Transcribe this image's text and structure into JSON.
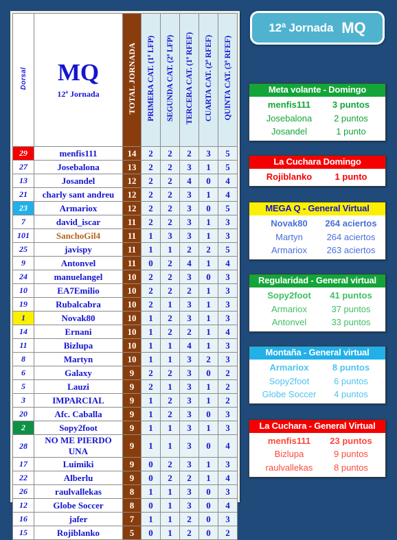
{
  "background_color": "#1f4a7a",
  "title_badge": {
    "jornada": "12ª Jornada",
    "name": "MQ",
    "bg_color": "#4fb3cf"
  },
  "table": {
    "header": {
      "dorsal": "Dorsal",
      "title_big": "MQ",
      "title_small": "12ª Jornada",
      "total": "TOTAL JORNADA",
      "cat1": "PRIMERA CAT. (1ª LFP)",
      "cat2": "SEGUNDA CAT. (2ª LFP)",
      "cat3": "TERCERA CAT. (1ª RFEF)",
      "cat4": "CUARTA CAT. (2ª RFEF)",
      "cat5": "QUINTA CAT. (3ª RFEF)"
    },
    "rows": [
      {
        "dorsal": "29",
        "name": "menfis111",
        "total": "14",
        "c1": "2",
        "c2": "2",
        "c3": "2",
        "c4": "3",
        "c5": "5",
        "dorsal_bg": "#f50000",
        "dorsal_fg": "#ffffff",
        "name_fg": "#1515cf"
      },
      {
        "dorsal": "27",
        "name": "Josebalona",
        "total": "13",
        "c1": "2",
        "c2": "2",
        "c3": "3",
        "c4": "1",
        "c5": "5",
        "dorsal_bg": "#ffffff",
        "dorsal_fg": "#1515cf",
        "name_fg": "#1515cf"
      },
      {
        "dorsal": "13",
        "name": "Josandel",
        "total": "12",
        "c1": "2",
        "c2": "2",
        "c3": "4",
        "c4": "0",
        "c5": "4",
        "dorsal_bg": "#ffffff",
        "dorsal_fg": "#1515cf",
        "name_fg": "#1515cf"
      },
      {
        "dorsal": "21",
        "name": "charly sant andreu",
        "total": "12",
        "c1": "2",
        "c2": "2",
        "c3": "3",
        "c4": "1",
        "c5": "4",
        "dorsal_bg": "#ffffff",
        "dorsal_fg": "#1515cf",
        "name_fg": "#1515cf"
      },
      {
        "dorsal": "23",
        "name": "Armariox",
        "total": "12",
        "c1": "2",
        "c2": "2",
        "c3": "3",
        "c4": "0",
        "c5": "5",
        "dorsal_bg": "#22b0e8",
        "dorsal_fg": "#ffffff",
        "name_fg": "#1515cf"
      },
      {
        "dorsal": "7",
        "name": "david_iscar",
        "total": "11",
        "c1": "2",
        "c2": "2",
        "c3": "3",
        "c4": "1",
        "c5": "3",
        "dorsal_bg": "#ffffff",
        "dorsal_fg": "#1515cf",
        "name_fg": "#1515cf"
      },
      {
        "dorsal": "101",
        "name": "SanchoGil4",
        "total": "11",
        "c1": "1",
        "c2": "3",
        "c3": "3",
        "c4": "1",
        "c5": "3",
        "dorsal_bg": "#ffffff",
        "dorsal_fg": "#1515cf",
        "name_fg": "#b5651d"
      },
      {
        "dorsal": "25",
        "name": "javispy",
        "total": "11",
        "c1": "1",
        "c2": "1",
        "c3": "2",
        "c4": "2",
        "c5": "5",
        "dorsal_bg": "#ffffff",
        "dorsal_fg": "#1515cf",
        "name_fg": "#1515cf"
      },
      {
        "dorsal": "9",
        "name": "Antonvel",
        "total": "11",
        "c1": "0",
        "c2": "2",
        "c3": "4",
        "c4": "1",
        "c5": "4",
        "dorsal_bg": "#ffffff",
        "dorsal_fg": "#1515cf",
        "name_fg": "#1515cf"
      },
      {
        "dorsal": "24",
        "name": "manuelangel",
        "total": "10",
        "c1": "2",
        "c2": "2",
        "c3": "3",
        "c4": "0",
        "c5": "3",
        "dorsal_bg": "#ffffff",
        "dorsal_fg": "#1515cf",
        "name_fg": "#1515cf"
      },
      {
        "dorsal": "10",
        "name": "EA7Emilio",
        "total": "10",
        "c1": "2",
        "c2": "2",
        "c3": "2",
        "c4": "1",
        "c5": "3",
        "dorsal_bg": "#ffffff",
        "dorsal_fg": "#1515cf",
        "name_fg": "#1515cf"
      },
      {
        "dorsal": "19",
        "name": "Rubalcabra",
        "total": "10",
        "c1": "2",
        "c2": "1",
        "c3": "3",
        "c4": "1",
        "c5": "3",
        "dorsal_bg": "#ffffff",
        "dorsal_fg": "#1515cf",
        "name_fg": "#1515cf"
      },
      {
        "dorsal": "1",
        "name": "Novak80",
        "total": "10",
        "c1": "1",
        "c2": "2",
        "c3": "3",
        "c4": "1",
        "c5": "3",
        "dorsal_bg": "#fbf000",
        "dorsal_fg": "#1515cf",
        "name_fg": "#1515cf"
      },
      {
        "dorsal": "14",
        "name": "Ernani",
        "total": "10",
        "c1": "1",
        "c2": "2",
        "c3": "2",
        "c4": "1",
        "c5": "4",
        "dorsal_bg": "#ffffff",
        "dorsal_fg": "#1515cf",
        "name_fg": "#1515cf"
      },
      {
        "dorsal": "11",
        "name": "Bizlupa",
        "total": "10",
        "c1": "1",
        "c2": "1",
        "c3": "4",
        "c4": "1",
        "c5": "3",
        "dorsal_bg": "#ffffff",
        "dorsal_fg": "#1515cf",
        "name_fg": "#1515cf"
      },
      {
        "dorsal": "8",
        "name": "Martyn",
        "total": "10",
        "c1": "1",
        "c2": "1",
        "c3": "3",
        "c4": "2",
        "c5": "3",
        "dorsal_bg": "#ffffff",
        "dorsal_fg": "#1515cf",
        "name_fg": "#1515cf"
      },
      {
        "dorsal": "6",
        "name": "Galaxy",
        "total": "9",
        "c1": "2",
        "c2": "2",
        "c3": "3",
        "c4": "0",
        "c5": "2",
        "dorsal_bg": "#ffffff",
        "dorsal_fg": "#1515cf",
        "name_fg": "#1515cf"
      },
      {
        "dorsal": "5",
        "name": "Lauzi",
        "total": "9",
        "c1": "2",
        "c2": "1",
        "c3": "3",
        "c4": "1",
        "c5": "2",
        "dorsal_bg": "#ffffff",
        "dorsal_fg": "#1515cf",
        "name_fg": "#1515cf"
      },
      {
        "dorsal": "3",
        "name": "IMPARCIAL",
        "total": "9",
        "c1": "1",
        "c2": "2",
        "c3": "3",
        "c4": "1",
        "c5": "2",
        "dorsal_bg": "#ffffff",
        "dorsal_fg": "#1515cf",
        "name_fg": "#1515cf"
      },
      {
        "dorsal": "20",
        "name": "Afc. Caballa",
        "total": "9",
        "c1": "1",
        "c2": "2",
        "c3": "3",
        "c4": "0",
        "c5": "3",
        "dorsal_bg": "#ffffff",
        "dorsal_fg": "#1515cf",
        "name_fg": "#1515cf"
      },
      {
        "dorsal": "2",
        "name": "Sopy2foot",
        "total": "9",
        "c1": "1",
        "c2": "1",
        "c3": "3",
        "c4": "1",
        "c5": "3",
        "dorsal_bg": "#0e9146",
        "dorsal_fg": "#ffffff",
        "name_fg": "#1515cf"
      },
      {
        "dorsal": "28",
        "name": "NO ME PIERDO UNA",
        "total": "9",
        "c1": "1",
        "c2": "1",
        "c3": "3",
        "c4": "0",
        "c5": "4",
        "dorsal_bg": "#ffffff",
        "dorsal_fg": "#1515cf",
        "name_fg": "#1515cf"
      },
      {
        "dorsal": "17",
        "name": "Luimiki",
        "total": "9",
        "c1": "0",
        "c2": "2",
        "c3": "3",
        "c4": "1",
        "c5": "3",
        "dorsal_bg": "#ffffff",
        "dorsal_fg": "#1515cf",
        "name_fg": "#1515cf"
      },
      {
        "dorsal": "22",
        "name": "Alberlu",
        "total": "9",
        "c1": "0",
        "c2": "2",
        "c3": "2",
        "c4": "1",
        "c5": "4",
        "dorsal_bg": "#ffffff",
        "dorsal_fg": "#1515cf",
        "name_fg": "#1515cf"
      },
      {
        "dorsal": "26",
        "name": "raulvallekas",
        "total": "8",
        "c1": "1",
        "c2": "1",
        "c3": "3",
        "c4": "0",
        "c5": "3",
        "dorsal_bg": "#ffffff",
        "dorsal_fg": "#1515cf",
        "name_fg": "#1515cf"
      },
      {
        "dorsal": "12",
        "name": "Globe Soccer",
        "total": "8",
        "c1": "0",
        "c2": "1",
        "c3": "3",
        "c4": "0",
        "c5": "4",
        "dorsal_bg": "#ffffff",
        "dorsal_fg": "#1515cf",
        "name_fg": "#1515cf"
      },
      {
        "dorsal": "16",
        "name": "jafer",
        "total": "7",
        "c1": "1",
        "c2": "1",
        "c3": "2",
        "c4": "0",
        "c5": "3",
        "dorsal_bg": "#ffffff",
        "dorsal_fg": "#1515cf",
        "name_fg": "#1515cf"
      },
      {
        "dorsal": "15",
        "name": "Rojiblanko",
        "total": "5",
        "c1": "0",
        "c2": "1",
        "c3": "2",
        "c4": "0",
        "c5": "2",
        "dorsal_bg": "#ffffff",
        "dorsal_fg": "#1515cf",
        "name_fg": "#1515cf"
      }
    ]
  },
  "panels": [
    {
      "id": "meta-volante-domingo",
      "header": "Meta  volante  -   Domingo",
      "header_bg": "#13a538",
      "header_fg": "#ffffff",
      "text_color": "#13a538",
      "rows": [
        {
          "name": "menfis111",
          "value": "3 puntos"
        },
        {
          "name": "Josebalona",
          "value": "2 puntos"
        },
        {
          "name": "Josandel",
          "value": "1 punto"
        }
      ]
    },
    {
      "id": "la-cuchara-domingo",
      "header": "La Cuchara           Domingo",
      "header_bg": "#f50000",
      "header_fg": "#ffffff",
      "text_color": "#f50000",
      "rows": [
        {
          "name": "Rojiblanko",
          "value": "1 punto"
        }
      ]
    },
    {
      "id": "mega-q-general-virtual",
      "header": "MEGA Q  -  General Virtual",
      "header_bg": "#fbf000",
      "header_fg": "#1515cf",
      "text_color": "#4a6fd8",
      "rows": [
        {
          "name": "Novak80",
          "value": "264 aciertos"
        },
        {
          "name": "Martyn",
          "value": "264 aciertos"
        },
        {
          "name": "Armariox",
          "value": "263 aciertos"
        }
      ]
    },
    {
      "id": "regularidad-general-virtual",
      "header": "Regularidad  -  General virtual",
      "header_bg": "#13a538",
      "header_fg": "#ffffff",
      "text_color": "#3fbf63",
      "rows": [
        {
          "name": "Sopy2foot",
          "value": "41 puntos"
        },
        {
          "name": "Armariox",
          "value": "37 puntos"
        },
        {
          "name": "Antonvel",
          "value": "33 puntos"
        }
      ]
    },
    {
      "id": "montana-general-virtual",
      "header": "Montaña  -  General virtual",
      "header_bg": "#22b0e8",
      "header_fg": "#ffffff",
      "text_color": "#4fc3f0",
      "rows": [
        {
          "name": "Armariox",
          "value": "8 puntos"
        },
        {
          "name": "Sopy2foot",
          "value": "6 puntos"
        },
        {
          "name": "Globe Soccer",
          "value": "4 puntos"
        }
      ]
    },
    {
      "id": "la-cuchara-general-virtual",
      "header": "La Cuchara - General Virtual",
      "header_bg": "#f50000",
      "header_fg": "#ffffff",
      "text_color": "#fb4a3a",
      "rows": [
        {
          "name": "menfis111",
          "value": "23 puntos"
        },
        {
          "name": "Bizlupa",
          "value": "9 puntos"
        },
        {
          "name": "raulvallekas",
          "value": "8 puntos"
        }
      ]
    }
  ]
}
